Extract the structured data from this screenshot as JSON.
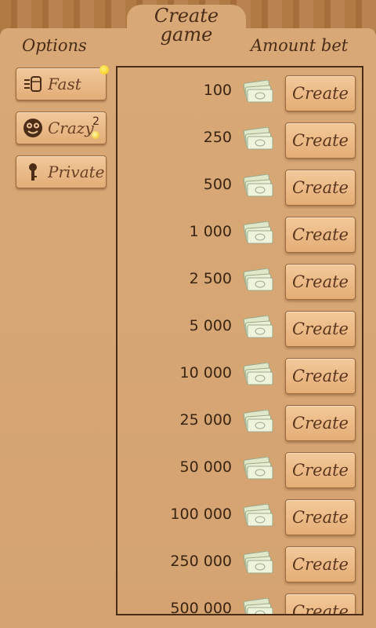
{
  "header": {
    "title_line1": "Create",
    "title_line2": "game"
  },
  "columns": {
    "options": "Options",
    "amount_bet": "Amount bet"
  },
  "options": [
    {
      "label": "Fast",
      "icon": "speed-icon"
    },
    {
      "label": "Crazy",
      "icon": "crazy-face-icon",
      "badge": "2"
    },
    {
      "label": "Private",
      "icon": "key-icon"
    }
  ],
  "bets": [
    {
      "amount": "100",
      "button": "Create"
    },
    {
      "amount": "250",
      "button": "Create"
    },
    {
      "amount": "500",
      "button": "Create"
    },
    {
      "amount": "1 000",
      "button": "Create"
    },
    {
      "amount": "2 500",
      "button": "Create"
    },
    {
      "amount": "5 000",
      "button": "Create"
    },
    {
      "amount": "10 000",
      "button": "Create"
    },
    {
      "amount": "25 000",
      "button": "Create"
    },
    {
      "amount": "50 000",
      "button": "Create"
    },
    {
      "amount": "100 000",
      "button": "Create"
    },
    {
      "amount": "250 000",
      "button": "Create"
    },
    {
      "amount": "500 000",
      "button": "Create"
    }
  ],
  "colors": {
    "wood_dark": "#4a2c17",
    "panel": "#d8a877",
    "button": "#f0c596"
  }
}
